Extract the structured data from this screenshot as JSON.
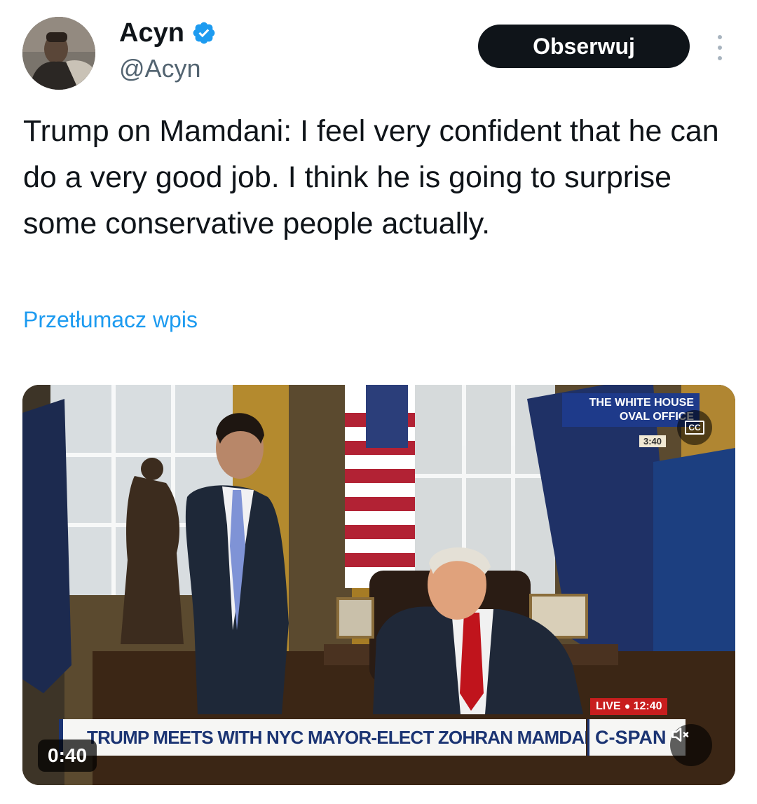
{
  "author": {
    "name": "Acyn",
    "handle": "@Acyn",
    "verified": true,
    "verified_icon": "verified-badge-icon",
    "avatar": "avatar-photo"
  },
  "actions": {
    "follow_label": "Obserwuj",
    "more_icon": "more-vertical-icon"
  },
  "tweet": {
    "text": "Trump on Mamdani: I feel very confident that he can do a very good job. I think he is going to surprise some conservative people actually.",
    "translate_label": "Przetłumacz wpis"
  },
  "video": {
    "duration": "0:40",
    "location_line1": "THE WHITE HOUSE",
    "location_line2": "OVAL OFFICE",
    "location_time": "3:40",
    "live_label": "LIVE",
    "live_time": "12:40",
    "chyron_text": "TRUMP MEETS WITH NYC MAYOR-ELECT ZOHRAN MAMDANI (D)",
    "network_label": "C-SPAN",
    "cc_label": "CC",
    "cc_icon": "closed-captions-icon",
    "mute_icon": "speaker-muted-icon"
  },
  "colors": {
    "link": "#1d9bf0",
    "follow_bg": "#0f1419",
    "secondary_text": "#536471",
    "verified": "#1d9bf0"
  }
}
